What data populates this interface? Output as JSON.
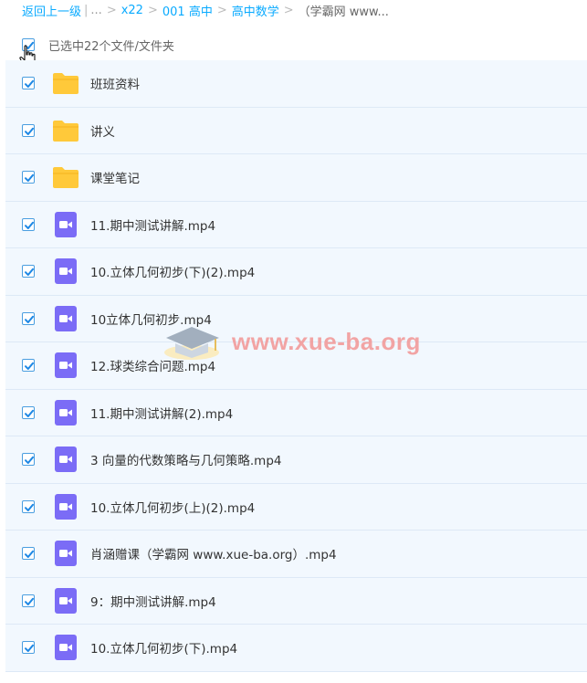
{
  "breadcrumb": {
    "back": "返回上一级",
    "divider": "|",
    "ellipsis": "...",
    "items": [
      "x22",
      "001 高中",
      "高中数学"
    ],
    "current": "（学霸网 www..."
  },
  "selection": {
    "text": "已选中22个文件/文件夹"
  },
  "files": [
    {
      "name": "班班资料",
      "type": "folder"
    },
    {
      "name": "讲义",
      "type": "folder"
    },
    {
      "name": "课堂笔记",
      "type": "folder"
    },
    {
      "name": "11.期中测试讲解.mp4",
      "type": "video"
    },
    {
      "name": "10.立体几何初步(下)(2).mp4",
      "type": "video"
    },
    {
      "name": "10立体几何初步.mp4",
      "type": "video"
    },
    {
      "name": "12.球类综合问题.mp4",
      "type": "video"
    },
    {
      "name": "11.期中测试讲解(2).mp4",
      "type": "video"
    },
    {
      "name": "3 向量的代数策略与几何策略.mp4",
      "type": "video"
    },
    {
      "name": "10.立体几何初步(上)(2).mp4",
      "type": "video"
    },
    {
      "name": "肖涵赠课（学霸网 www.xue-ba.org）.mp4",
      "type": "video"
    },
    {
      "name": "9：期中测试讲解.mp4",
      "type": "video"
    },
    {
      "name": "10.立体几何初步(下).mp4",
      "type": "video"
    }
  ],
  "watermark": {
    "text": "www.xue-ba.org"
  },
  "colors": {
    "link": "#09AAFF",
    "row_bg": "#f2f8fe",
    "folder": "#FFC93A",
    "video": "#7B6CF6",
    "watermark": "#f29b9b"
  }
}
